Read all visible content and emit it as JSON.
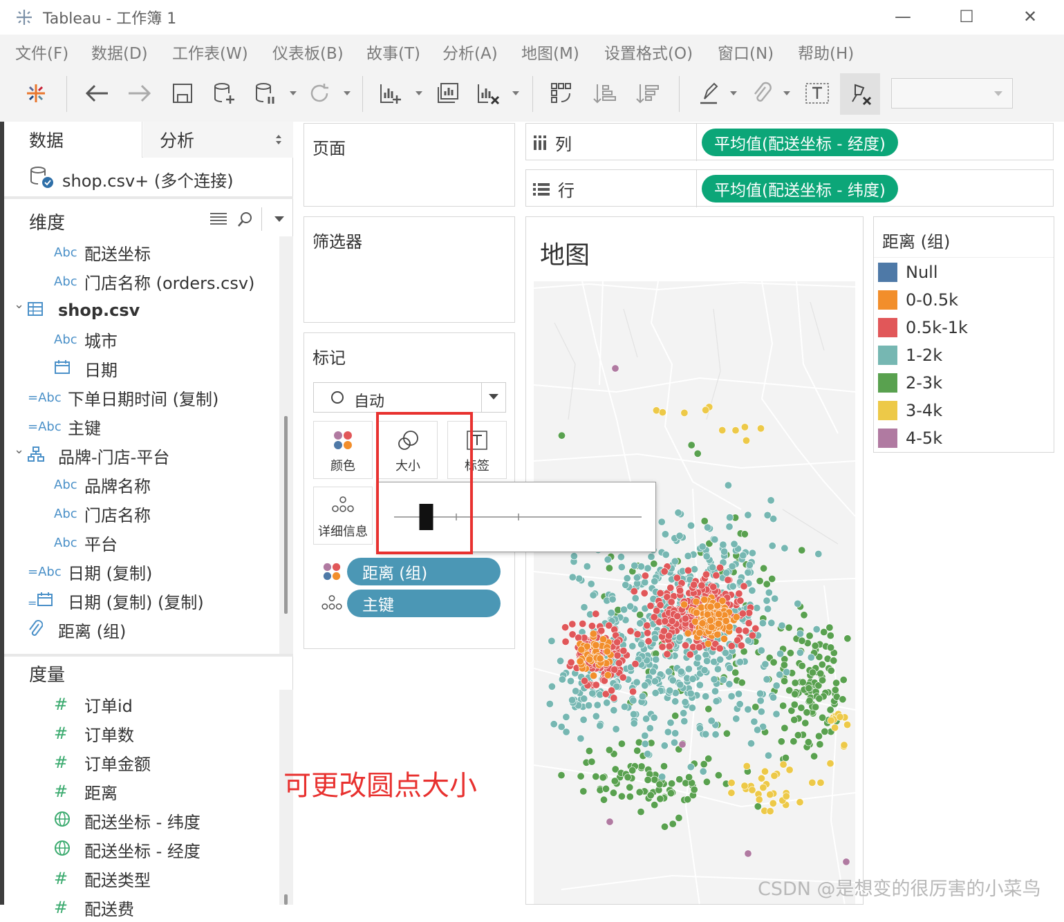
{
  "window": {
    "title": "Tableau - 工作簿 1",
    "minimize": "—",
    "maximize": "☐",
    "close": "✕"
  },
  "menu": [
    "文件(F)",
    "数据(D)",
    "工作表(W)",
    "仪表板(B)",
    "故事(T)",
    "分析(A)",
    "地图(M)",
    "设置格式(O)",
    "窗口(N)",
    "帮助(H)"
  ],
  "toolbar": {
    "icons": [
      "tableau-logo-icon",
      "back-icon",
      "forward-icon",
      "save-icon",
      "new-datasource-icon",
      "pause-updates-icon",
      "refresh-icon",
      "new-worksheet-icon",
      "duplicate-sheet-icon",
      "clear-sheet-icon",
      "swap-icon",
      "sort-ascending-icon",
      "sort-descending-icon",
      "highlight-icon",
      "group-icon",
      "label-icon",
      "fix-axes-icon"
    ],
    "combo_value": ""
  },
  "datapane": {
    "tabs": [
      "数据",
      "分析"
    ],
    "connection": "shop.csv+ (多个连接)",
    "dimensions_title": "维度",
    "dimensions": [
      {
        "type": "Abc",
        "name": "配送坐标",
        "indent": 1
      },
      {
        "type": "Abc",
        "name": "门店名称 (orders.csv)",
        "indent": 1
      },
      {
        "type": "table",
        "name": "shop.csv",
        "indent": 0,
        "bold": true
      },
      {
        "type": "Abc",
        "name": "城市",
        "indent": 1
      },
      {
        "type": "date",
        "name": "日期",
        "indent": 1
      },
      {
        "type": "=Abc",
        "name": "下单日期时间 (复制)",
        "indent": 0
      },
      {
        "type": "=Abc",
        "name": "主键",
        "indent": 0
      },
      {
        "type": "hier",
        "name": "品牌-门店-平台",
        "indent": 0
      },
      {
        "type": "Abc",
        "name": "品牌名称",
        "indent": 1
      },
      {
        "type": "Abc",
        "name": "门店名称",
        "indent": 1
      },
      {
        "type": "Abc",
        "name": "平台",
        "indent": 1
      },
      {
        "type": "=Abc",
        "name": "日期 (复制)",
        "indent": 0
      },
      {
        "type": "=date",
        "name": "日期 (复制) (复制)",
        "indent": 0
      },
      {
        "type": "clip",
        "name": "距离 (组)",
        "indent": 0
      }
    ],
    "measures_title": "度量",
    "measures": [
      {
        "type": "#",
        "name": "订单id"
      },
      {
        "type": "#",
        "name": "订单数"
      },
      {
        "type": "#",
        "name": "订单金额"
      },
      {
        "type": "#",
        "name": "距离"
      },
      {
        "type": "globe",
        "name": "配送坐标 - 纬度"
      },
      {
        "type": "globe",
        "name": "配送坐标 - 经度"
      },
      {
        "type": "#",
        "name": "配送类型"
      },
      {
        "type": "#",
        "name": "配送费"
      }
    ]
  },
  "pages": {
    "title": "页面"
  },
  "filters": {
    "title": "筛选器"
  },
  "marks": {
    "title": "标记",
    "type": "自动",
    "buttons": [
      "颜色",
      "大小",
      "标签",
      "详细信息"
    ],
    "pills": [
      {
        "icon": "color-icon",
        "label": "距离 (组)"
      },
      {
        "icon": "detail-icon",
        "label": "主键"
      }
    ]
  },
  "columns": {
    "label": "列",
    "pill": "平均值(配送坐标 - 经度)"
  },
  "rows": {
    "label": "行",
    "pill": "平均值(配送坐标 - 纬度)"
  },
  "view": {
    "title": "地图"
  },
  "legend": {
    "title": "距离 (组)",
    "items": [
      {
        "label": "Null",
        "color": "#4e79a7"
      },
      {
        "label": "0-0.5k",
        "color": "#f28e2b"
      },
      {
        "label": "0.5k-1k",
        "color": "#e15759"
      },
      {
        "label": "1-2k",
        "color": "#76b7b2"
      },
      {
        "label": "2-3k",
        "color": "#59a14f"
      },
      {
        "label": "3-4k",
        "color": "#edc948"
      },
      {
        "label": "4-5k",
        "color": "#b07aa1"
      }
    ]
  },
  "size_slider": {
    "value": 0.13
  },
  "annotation": "可更改圆点大小",
  "watermark": "CSDN @是想变的很厉害的小菜鸟"
}
